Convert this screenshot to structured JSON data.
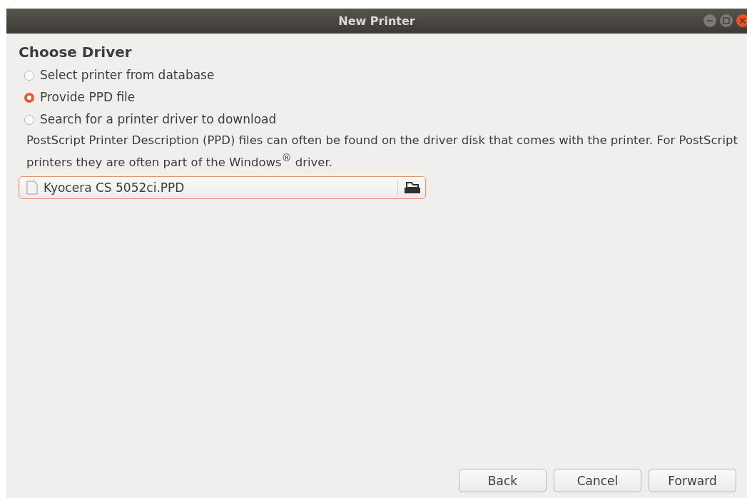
{
  "window": {
    "title": "New Printer"
  },
  "heading": "Choose Driver",
  "options": [
    {
      "label": "Select printer from database",
      "selected": false
    },
    {
      "label": "Provide PPD file",
      "selected": true
    },
    {
      "label": "Search for a printer driver to download",
      "selected": false
    }
  ],
  "description": "PostScript Printer Description (PPD) files can often be found on the driver disk that comes with the printer. For PostScript printers they are often part of the Windows$^{®}$ driver.",
  "file_chooser": {
    "value": "Kyocera CS 5052ci.PPD"
  },
  "buttons": [
    "Back",
    "Cancel",
    "Forward"
  ]
}
